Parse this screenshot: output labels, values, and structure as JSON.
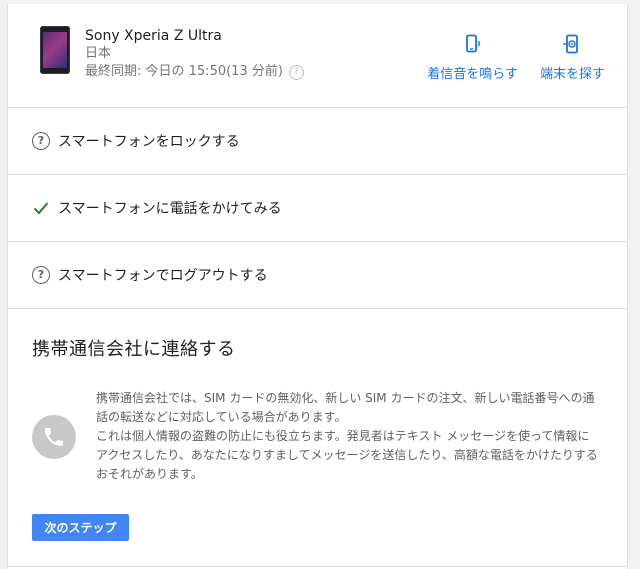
{
  "device": {
    "name": "Sony Xperia Z Ultra",
    "country": "日本",
    "last_sync": "最終同期: 今日の 15:50(13 分前)",
    "help_glyph": "?",
    "image_icon": "phone-image"
  },
  "actions": [
    {
      "label": "着信音を鳴らす",
      "icon": "ring-phone-icon"
    },
    {
      "label": "端末を探す",
      "icon": "locate-device-icon"
    }
  ],
  "options": [
    {
      "label": "スマートフォンをロックする",
      "icon": "help-circle-icon",
      "glyph": "?"
    },
    {
      "label": "スマートフォンに電話をかけてみる",
      "icon": "checkmark-icon",
      "glyph": ""
    },
    {
      "label": "スマートフォンでログアウトする",
      "icon": "help-circle-icon",
      "glyph": "?"
    }
  ],
  "contact": {
    "title": "携帯通信会社に連絡する",
    "paragraph1": "携帯通信会社では、SIM カードの無効化、新しい SIM カードの注文、新しい電話番号への通話の転送などに対応している場合があります。",
    "paragraph2": "これは個人情報の盗難の防止にも役立ちます。発見者はテキスト メッセージを使って情報にアクセスしたり、あなたになりすましてメッセージを送信したり、高額な電話をかけたりするおそれがあります。",
    "icon": "phone-call-icon",
    "next_label": "次のステップ"
  },
  "colors": {
    "accent": "#1a73e8",
    "button": "#4285f4",
    "check": "#2e7d32",
    "divider": "#e0e0e0"
  }
}
